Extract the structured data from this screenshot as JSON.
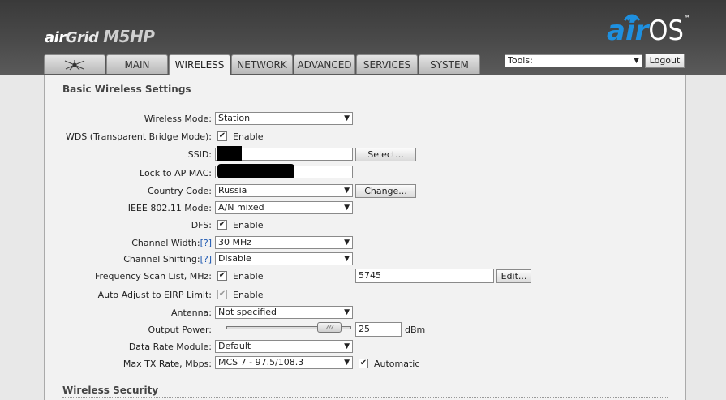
{
  "brand": {
    "device_air": "air",
    "device_grid": "Grid",
    "device_model": "M5HP",
    "os_air": "air",
    "os_os": "OS",
    "os_tm": "™"
  },
  "tabs": [
    {
      "label": "",
      "icon": "ubiquiti-logo-icon"
    },
    {
      "label": "MAIN"
    },
    {
      "label": "WIRELESS",
      "active": true
    },
    {
      "label": "NETWORK"
    },
    {
      "label": "ADVANCED"
    },
    {
      "label": "SERVICES"
    },
    {
      "label": "SYSTEM"
    }
  ],
  "tools": {
    "label": "Tools:",
    "logout": "Logout"
  },
  "basic": {
    "title": "Basic Wireless Settings",
    "wireless_mode": {
      "label": "Wireless Mode:",
      "value": "Station"
    },
    "wds": {
      "label": "WDS (Transparent Bridge Mode):",
      "check": "Enable"
    },
    "ssid": {
      "label": "SSID:",
      "button": "Select..."
    },
    "lock_ap": {
      "label": "Lock to AP MAC:"
    },
    "country": {
      "label": "Country Code:",
      "value": "Russia",
      "button": "Change..."
    },
    "ieee": {
      "label": "IEEE 802.11 Mode:",
      "value": "A/N mixed"
    },
    "dfs": {
      "label": "DFS:",
      "check": "Enable"
    },
    "channel_width": {
      "label": "Channel Width:",
      "help": "[?]",
      "value": "30 MHz"
    },
    "channel_shifting": {
      "label": "Channel Shifting:",
      "help": "[?]",
      "value": "Disable"
    },
    "freq_scan": {
      "label": "Frequency Scan List, MHz:",
      "check": "Enable",
      "value": "5745",
      "button": "Edit..."
    },
    "auto_adjust": {
      "label": "Auto Adjust to EIRP Limit:",
      "check": "Enable"
    },
    "antenna": {
      "label": "Antenna:",
      "value": "Not specified"
    },
    "output_power": {
      "label": "Output Power:",
      "value": "25",
      "unit": "dBm",
      "slider_level": 0.9
    },
    "data_rate": {
      "label": "Data Rate Module:",
      "value": "Default"
    },
    "max_tx": {
      "label": "Max TX Rate, Mbps:",
      "value": "MCS 7 - 97.5/108.3",
      "check": "Automatic"
    }
  },
  "security": {
    "title": "Wireless Security"
  },
  "glyphs": {
    "arrow": "▼",
    "check": "✔"
  }
}
